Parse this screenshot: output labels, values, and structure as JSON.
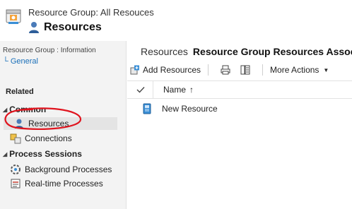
{
  "header": {
    "breadcrumb": "Resource Group: All Resouces",
    "title": "Resources"
  },
  "left": {
    "info_label": "Resource Group : Information",
    "general_link": "└ General",
    "related_label": "Related",
    "groups": [
      {
        "label": "Common",
        "items": [
          "Resources",
          "Connections"
        ]
      },
      {
        "label": "Process Sessions",
        "items": [
          "Background Processes",
          "Real-time Processes"
        ]
      }
    ]
  },
  "main": {
    "entity_label": "Resources",
    "subgrid_title": "Resource Group Resources Assoc",
    "toolbar": {
      "add_label": "Add Resources",
      "more_label": "More Actions"
    },
    "grid": {
      "column_name": "Name",
      "sort_arrow": "↑",
      "rows": [
        "New Resource"
      ]
    }
  },
  "colors": {
    "accent_link": "#1a6fb8",
    "highlight_circle": "#e0141e",
    "nav_background": "#f3f3f3",
    "active_item": "#e4e4e4"
  },
  "icons": [
    "app-record-icon",
    "user-icon",
    "add-icon",
    "print-icon",
    "report-icon",
    "chevron-down-icon",
    "check-icon",
    "device-icon",
    "connections-icon",
    "background-process-icon",
    "realtime-process-icon"
  ]
}
